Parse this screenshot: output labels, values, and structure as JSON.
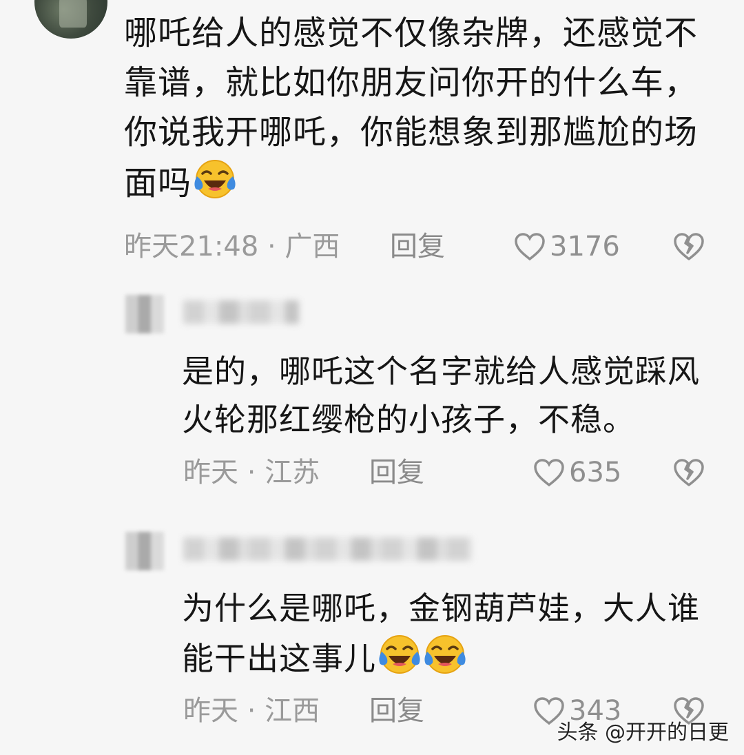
{
  "comments": [
    {
      "text": "哪吒给人的感觉不仅像杂牌，还感觉不靠谱，就比如你朋友问你开的什么车，你说我开哪吒，你能想象到那尴尬的场面吗",
      "emoji_count": 1,
      "time_location": "昨天21:48 · 广西",
      "reply_label": "回复",
      "likes": "3176"
    },
    {
      "text": "是的，哪吒这个名字就给人感觉踩风火轮那红缨枪的小孩子，不稳。",
      "emoji_count": 0,
      "time_location": "昨天 · 江苏",
      "reply_label": "回复",
      "likes": "635"
    },
    {
      "text": "为什么是哪吒，金钢葫芦娃，大人谁能干出这事儿",
      "emoji_count": 2,
      "time_location": "昨天 · 江西",
      "reply_label": "回复",
      "likes": "343"
    }
  ],
  "emoji_name": "laughing-crying-emoji",
  "watermark": "头条 @开开的日更",
  "colors": {
    "background": "#f6f6f6",
    "meta_text": "#9a9a9a",
    "emoji_face": "#f7c22c",
    "emoji_tear": "#3f8be0"
  }
}
